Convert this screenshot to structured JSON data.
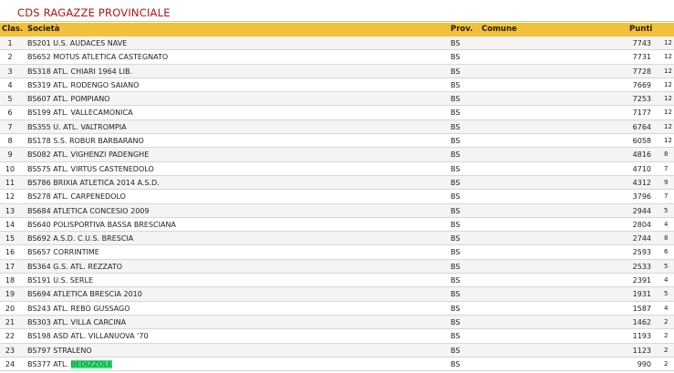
{
  "page": {
    "title": "CDS RAGAZZE PROVINCIALE"
  },
  "table": {
    "headers": {
      "rank": "Clas.",
      "team": "Società",
      "prov": "Prov.",
      "comune": "Comune",
      "points": "Punti"
    },
    "rows": [
      {
        "rank": "1",
        "team": "BS201 U.S. AUDACES NAVE",
        "prov": "BS",
        "points": "7743",
        "extra": "12"
      },
      {
        "rank": "2",
        "team": "BS652 MOTUS ATLETICA CASTEGNATO",
        "prov": "BS",
        "points": "7731",
        "extra": "12"
      },
      {
        "rank": "3",
        "team": "BS318 ATL. CHIARI 1964 LIB.",
        "prov": "BS",
        "points": "7728",
        "extra": "12"
      },
      {
        "rank": "4",
        "team": "BS319 ATL. RODENGO SAIANO",
        "prov": "BS",
        "points": "7669",
        "extra": "12"
      },
      {
        "rank": "5",
        "team": "BS607 ATL. POMPIANO",
        "prov": "BS",
        "points": "7253",
        "extra": "12"
      },
      {
        "rank": "6",
        "team": "BS199 ATL. VALLECAMONICA",
        "prov": "BS",
        "points": "7177",
        "extra": "12"
      },
      {
        "rank": "7",
        "team": "BS355 U. ATL. VALTROMPIA",
        "prov": "BS",
        "points": "6764",
        "extra": "12"
      },
      {
        "rank": "8",
        "team": "BS178 S.S. ROBUR BARBARANO",
        "prov": "BS",
        "points": "6058",
        "extra": "12"
      },
      {
        "rank": "9",
        "team": "BS082 ATL. VIGHENZI PADENGHE",
        "prov": "BS",
        "points": "4816",
        "extra": "8"
      },
      {
        "rank": "10",
        "team": "BS575 ATL. VIRTUS CASTENEDOLO",
        "prov": "BS",
        "points": "4710",
        "extra": "7"
      },
      {
        "rank": "11",
        "team": "BS786 BRIXIA ATLETICA 2014 A.S.D.",
        "prov": "BS",
        "points": "4312",
        "extra": "9"
      },
      {
        "rank": "12",
        "team": "BS278 ATL. CARPENEDOLO",
        "prov": "BS",
        "points": "3796",
        "extra": "7"
      },
      {
        "rank": "13",
        "team": "BS684 ATLETICA CONCESIO 2009",
        "prov": "BS",
        "points": "2944",
        "extra": "5"
      },
      {
        "rank": "14",
        "team": "BS640 POLISPORTIVA BASSA BRESCIANA",
        "prov": "BS",
        "points": "2804",
        "extra": "4"
      },
      {
        "rank": "15",
        "team": "BS692 A.S.D. C.U.S. BRESCIA",
        "prov": "BS",
        "points": "2744",
        "extra": "8"
      },
      {
        "rank": "16",
        "team": "BS657 CORRINTIME",
        "prov": "BS",
        "points": "2593",
        "extra": "6"
      },
      {
        "rank": "17",
        "team": "BS364 G.S. ATL. REZZATO",
        "prov": "BS",
        "points": "2533",
        "extra": "5"
      },
      {
        "rank": "18",
        "team": "BS191 U.S. SERLE",
        "prov": "BS",
        "points": "2391",
        "extra": "4"
      },
      {
        "rank": "19",
        "team": "BS694 ATLETICA BRESCIA 2010",
        "prov": "BS",
        "points": "1931",
        "extra": "5"
      },
      {
        "rank": "20",
        "team": "BS243 ATL. REBO GUSSAGO",
        "prov": "BS",
        "points": "1587",
        "extra": "4"
      },
      {
        "rank": "21",
        "team": "BS303 ATL. VILLA CARCINA",
        "prov": "BS",
        "points": "1462",
        "extra": "2"
      },
      {
        "rank": "22",
        "team": "BS198 ASD ATL. VILLANUOVA '70",
        "prov": "BS",
        "points": "1193",
        "extra": "2"
      },
      {
        "rank": "23",
        "team": "BS797 STRALENO",
        "prov": "BS",
        "points": "1123",
        "extra": "2"
      },
      {
        "rank": "24",
        "team": "BS377 ATL. ",
        "team_highlight": "BEDIZZOLE",
        "prov": "BS",
        "points": "990",
        "extra": "2"
      }
    ]
  },
  "colors": {
    "title": "#b41212",
    "header_bg": "#f0c23c",
    "row_alt": "#f4f4f4",
    "highlight": "#39e07a"
  }
}
